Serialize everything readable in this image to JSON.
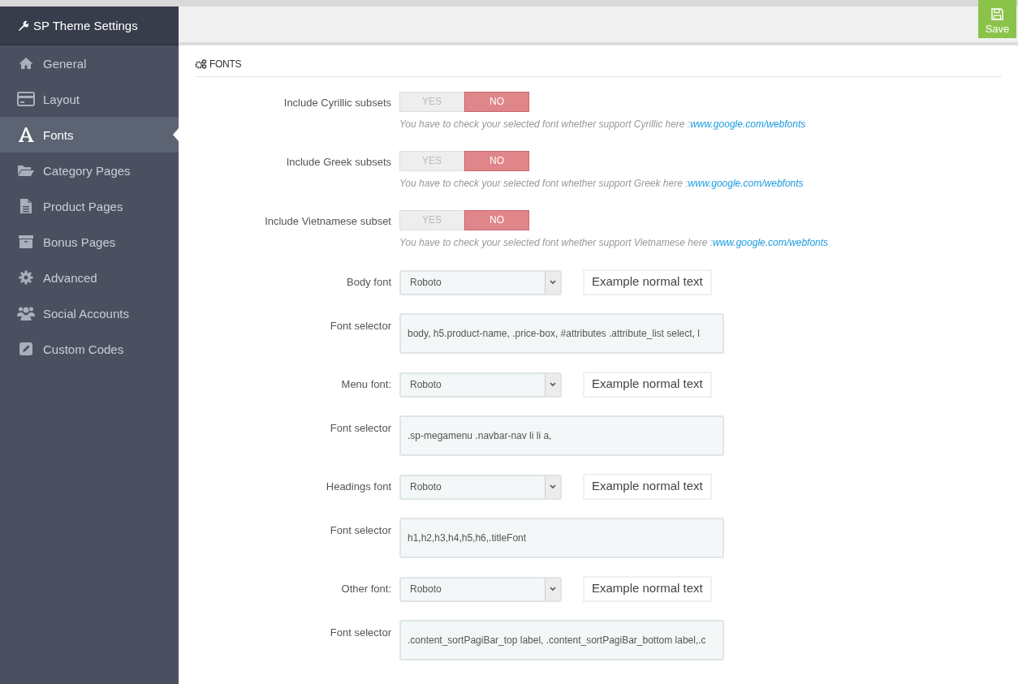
{
  "sidebar": {
    "title": "SP Theme Settings",
    "items": [
      {
        "label": "General",
        "selected": false
      },
      {
        "label": "Layout",
        "selected": false
      },
      {
        "label": "Fonts",
        "selected": true
      },
      {
        "label": "Category Pages",
        "selected": false
      },
      {
        "label": "Product Pages",
        "selected": false
      },
      {
        "label": "Bonus Pages",
        "selected": false
      },
      {
        "label": "Advanced",
        "selected": false
      },
      {
        "label": "Social Accounts",
        "selected": false
      },
      {
        "label": "Custom Codes",
        "selected": false
      }
    ]
  },
  "toolbar": {
    "save_label": "Save"
  },
  "section": {
    "title": "FONTS",
    "rows": [
      {
        "kind": "toggle",
        "label": "Include Cyrillic subsets",
        "options": [
          {
            "label": "YES",
            "selected": false
          },
          {
            "label": "NO",
            "selected": true
          }
        ],
        "help": "You have to check your selected font whether support Cyrillic here :",
        "link": "www.google.com/webfonts"
      },
      {
        "kind": "toggle",
        "label": "Include Greek subsets",
        "options": [
          {
            "label": "YES",
            "selected": false
          },
          {
            "label": "NO",
            "selected": true
          }
        ],
        "help": "You have to check your selected font whether support Greek here :",
        "link": "www.google.com/webfonts"
      },
      {
        "kind": "toggle",
        "label": "Include Vietnamese subset",
        "options": [
          {
            "label": "YES",
            "selected": false
          },
          {
            "label": "NO",
            "selected": true
          }
        ],
        "help": "You have to check your selected font whether support Vietnamese here :",
        "link": "www.google.com/webfonts"
      },
      {
        "kind": "select",
        "label": "Body font",
        "value": "Roboto",
        "preview": "Example normal text"
      },
      {
        "kind": "textarea",
        "label": "Font selector",
        "value": "body, h5.product-name, .price-box, #attributes .attribute_list select, l"
      },
      {
        "kind": "select",
        "label": "Menu font:",
        "value": "Roboto",
        "preview": "Example normal text"
      },
      {
        "kind": "textarea",
        "label": "Font selector",
        "value": ".sp-megamenu .navbar-nav  li li a,"
      },
      {
        "kind": "select",
        "label": "Headings font",
        "value": "Roboto",
        "preview": "Example normal text"
      },
      {
        "kind": "textarea",
        "label": "Font selector",
        "value": "h1,h2,h3,h4,h5,h6,.titleFont"
      },
      {
        "kind": "select",
        "label": "Other font:",
        "value": "Roboto",
        "preview": "Example normal text"
      },
      {
        "kind": "textarea",
        "label": "Font selector",
        "value": ".content_sortPagiBar_top label, .content_sortPagiBar_bottom label,.c"
      }
    ]
  }
}
